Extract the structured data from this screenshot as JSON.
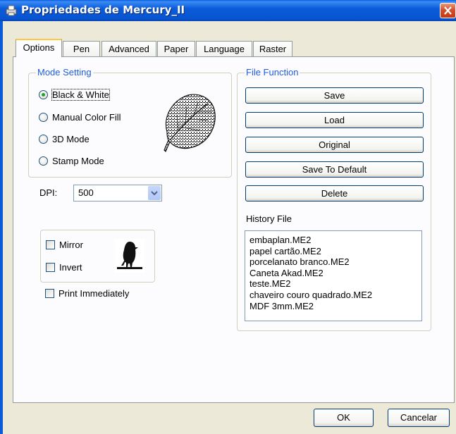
{
  "window": {
    "title": "Propriedades de Mercury_II",
    "close_icon": "close-icon"
  },
  "tabs": [
    {
      "label": "Options",
      "active": true
    },
    {
      "label": "Pen"
    },
    {
      "label": "Advanced"
    },
    {
      "label": "Paper"
    },
    {
      "label": "Language"
    },
    {
      "label": "Raster"
    }
  ],
  "mode_setting": {
    "label": "Mode Setting",
    "options": [
      {
        "label": "Black & White",
        "checked": true
      },
      {
        "label": "Manual Color Fill"
      },
      {
        "label": "3D Mode"
      },
      {
        "label": "Stamp Mode"
      }
    ]
  },
  "dpi": {
    "label": "DPI:",
    "value": "500"
  },
  "options": {
    "mirror": "Mirror",
    "invert": "Invert",
    "print_immediately": "Print Immediately"
  },
  "file_function": {
    "label": "File Function",
    "buttons": [
      "Save",
      "Load",
      "Original",
      "Save To Default",
      "Delete"
    ],
    "history_label": "History File",
    "history": [
      "embaplan.ME2",
      "papel cartão.ME2",
      "porcelanato branco.ME2",
      "Caneta Akad.ME2",
      "teste.ME2",
      "chaveiro couro quadrado.ME2",
      "MDF 3mm.ME2"
    ]
  },
  "footer": {
    "ok": "OK",
    "cancel": "Cancelar"
  },
  "colors": {
    "titlebar": "#0A5FE0",
    "group_label": "#1F5DDC",
    "accent_tab": "#FFC83C"
  }
}
